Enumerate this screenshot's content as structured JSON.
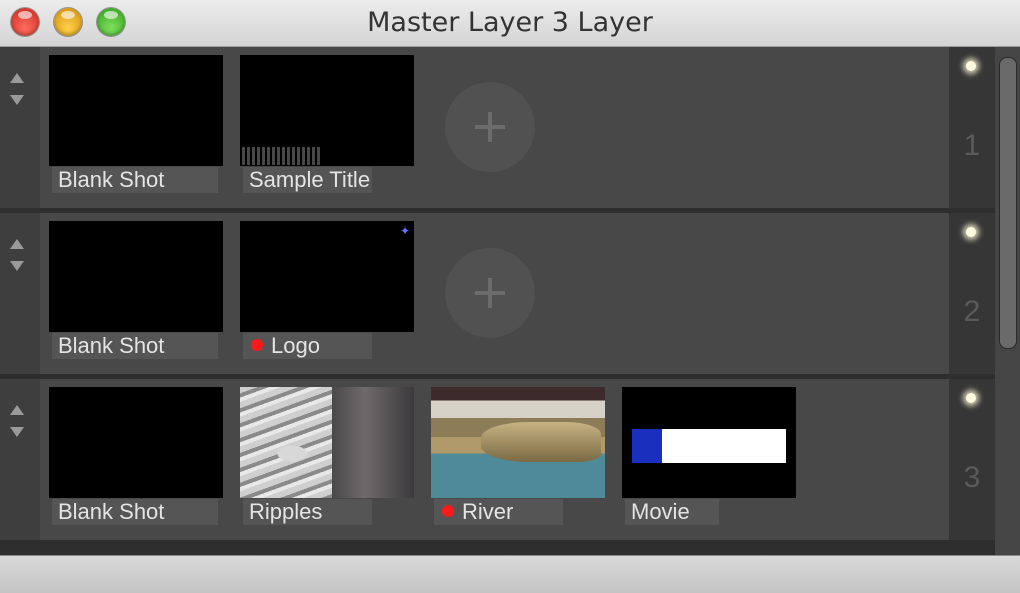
{
  "window": {
    "title": "Master Layer 3 Layer"
  },
  "icons": {
    "move_up": "triangle-up-icon",
    "move_down": "triangle-down-icon",
    "add": "plus-icon",
    "active_indicator": "led-icon",
    "live_marker": "red-dot-icon"
  },
  "colors": {
    "live_dot": "#ff1a1a",
    "led": "#fff9e0"
  },
  "layers": [
    {
      "number": "1",
      "shots": [
        {
          "label": "Blank Shot",
          "live": false
        },
        {
          "label": "Sample Title",
          "live": false
        }
      ]
    },
    {
      "number": "2",
      "shots": [
        {
          "label": "Blank Shot",
          "live": false
        },
        {
          "label": "Logo",
          "live": true
        }
      ]
    },
    {
      "number": "3",
      "shots": [
        {
          "label": "Blank Shot",
          "live": false
        },
        {
          "label": "Ripples",
          "live": false
        },
        {
          "label": "River",
          "live": true
        },
        {
          "label": "Movie",
          "live": false
        }
      ]
    }
  ]
}
